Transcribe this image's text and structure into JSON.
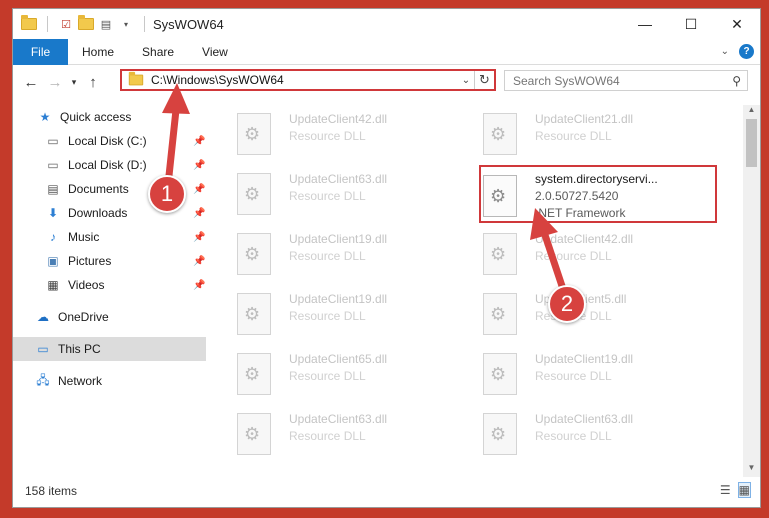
{
  "window": {
    "title": "SysWOW64"
  },
  "window_controls": {
    "minimize": "—",
    "maximize": "☐",
    "close": "✕"
  },
  "ribbon": {
    "file": "File",
    "tabs": [
      "Home",
      "Share",
      "View"
    ]
  },
  "address": {
    "path": "C:\\Windows\\SysWOW64"
  },
  "search": {
    "placeholder": "Search SysWOW64"
  },
  "sidebar": {
    "items": [
      {
        "label": "Quick access",
        "icon": "star-icon"
      },
      {
        "label": "Local Disk (C:)",
        "icon": "drive-icon",
        "pinned": true
      },
      {
        "label": "Local Disk (D:)",
        "icon": "drive-icon",
        "pinned": true
      },
      {
        "label": "Documents",
        "icon": "documents-icon",
        "pinned": true
      },
      {
        "label": "Downloads",
        "icon": "download-icon",
        "pinned": true
      },
      {
        "label": "Music",
        "icon": "music-icon",
        "pinned": true
      },
      {
        "label": "Pictures",
        "icon": "pictures-icon",
        "pinned": true
      },
      {
        "label": "Videos",
        "icon": "videos-icon",
        "pinned": true
      },
      {
        "label": "OneDrive",
        "icon": "cloud-icon"
      },
      {
        "label": "This PC",
        "icon": "computer-icon",
        "selected": true
      },
      {
        "label": "Network",
        "icon": "network-icon"
      }
    ]
  },
  "files": {
    "left": [
      {
        "name": "UpdateClient42.dll",
        "type": "Resource DLL"
      },
      {
        "name": "UpdateClient63.dll",
        "type": "Resource DLL"
      },
      {
        "name": "UpdateClient19.dll",
        "type": "Resource DLL"
      },
      {
        "name": "UpdateClient19.dll",
        "type": "Resource DLL"
      },
      {
        "name": "UpdateClient65.dll",
        "type": "Resource DLL"
      },
      {
        "name": "UpdateClient63.dll",
        "type": "Resource DLL"
      }
    ],
    "right": [
      {
        "name": "UpdateClient21.dll",
        "type": "Resource DLL"
      },
      {
        "name": "system.directoryservi...",
        "version": "2.0.50727.5420",
        "type": ".NET Framework",
        "highlighted": true
      },
      {
        "name": "UpdateClient42.dll",
        "type": "Resource DLL"
      },
      {
        "name": "UpdateClient5.dll",
        "type": "Resource DLL"
      },
      {
        "name": "UpdateClient19.dll",
        "type": "Resource DLL"
      },
      {
        "name": "UpdateClient63.dll",
        "type": "Resource DLL"
      }
    ]
  },
  "status": {
    "items": "158 items"
  },
  "annotations": {
    "badge1": "1",
    "badge2": "2",
    "color": "#d7423f"
  }
}
